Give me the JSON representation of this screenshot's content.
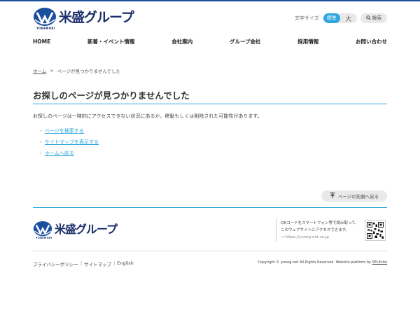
{
  "header": {
    "logo_text": "米盛グループ",
    "logo_sub": "YONEMORI",
    "font_size_label": "文字サイズ",
    "font_size_standard": "標準",
    "font_size_large": "大",
    "search_label": "検索"
  },
  "nav": {
    "items": [
      {
        "label": "HOME"
      },
      {
        "label": "新着・イベント情報"
      },
      {
        "label": "会社案内"
      },
      {
        "label": "グループ会社"
      },
      {
        "label": "採用情報"
      },
      {
        "label": "お問い合わせ"
      }
    ]
  },
  "breadcrumb": {
    "home": "ホーム",
    "separator": ">",
    "current": "ページが見つかりませんでした"
  },
  "main": {
    "title": "お探しのページが見つかりませんでした",
    "lead": "お探しのページは一時的にアクセスできない状況にあるか、移動もしくは削除された可能性があります。",
    "links": [
      {
        "label": "ページを検索する"
      },
      {
        "label": "サイトマップを表示する"
      },
      {
        "label": "ホームへ戻る"
      }
    ],
    "page_top": "ページの先頭へ戻る"
  },
  "footer": {
    "logo_text": "米盛グループ",
    "logo_sub": "YONEMORI",
    "qr_line1": "QRコードをスマートフォン等で読み取って、",
    "qr_line2": "このウェブサイトにアクセスできます。",
    "qr_url": "https://yoneg-net.co.jp",
    "links": {
      "privacy": "プライバシーポリシー",
      "sitemap": "サイトマップ",
      "english": "English",
      "sep": "|"
    },
    "copyright": "Copyright © yoneg-net All Rights Reserved. Website platform by ",
    "platform": "SELEsite"
  },
  "colors": {
    "accent": "#2ea7df",
    "brand": "#1a2f6b"
  },
  "icons": {
    "search": "search-icon",
    "page_top": "arrow-up-to-line-icon",
    "qr_arrow": "arrow-right-icon"
  }
}
